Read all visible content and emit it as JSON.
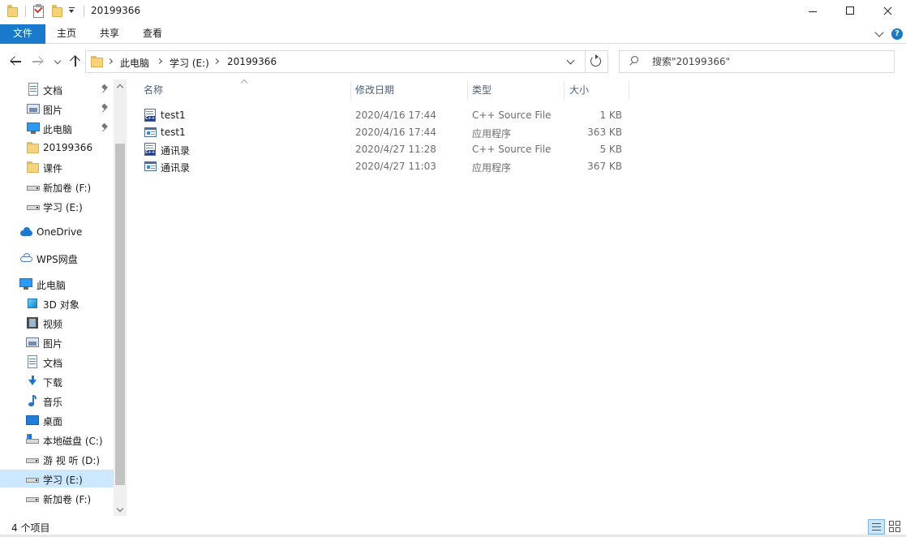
{
  "window": {
    "title": "20199366",
    "controls": [
      "minimize-icon",
      "maximize-icon",
      "close-icon"
    ]
  },
  "ribbon": {
    "file_tab": "文件",
    "tabs": [
      "主页",
      "共享",
      "查看"
    ]
  },
  "address": {
    "crumbs": [
      "此电脑",
      "学习 (E:)",
      "20199366"
    ]
  },
  "search": {
    "placeholder": "搜索\"20199366\""
  },
  "nav": {
    "quick_access": [
      {
        "label": "文档",
        "icon": "documents-icon",
        "pinned": true
      },
      {
        "label": "图片",
        "icon": "pictures-icon",
        "pinned": true
      },
      {
        "label": "此电脑",
        "icon": "this-pc-icon",
        "pinned": true
      },
      {
        "label": "20199366",
        "icon": "folder-icon",
        "pinned": false
      },
      {
        "label": "课件",
        "icon": "folder-icon",
        "pinned": false
      },
      {
        "label": "新加卷 (F:)",
        "icon": "drive-icon",
        "pinned": false
      },
      {
        "label": "学习 (E:)",
        "icon": "drive-icon",
        "pinned": false
      }
    ],
    "onedrive": "OneDrive",
    "wps": "WPS网盘",
    "this_pc": "此电脑",
    "this_pc_items": [
      {
        "label": "3D 对象",
        "icon": "3d-objects-icon"
      },
      {
        "label": "视频",
        "icon": "videos-icon"
      },
      {
        "label": "图片",
        "icon": "pictures-icon"
      },
      {
        "label": "文档",
        "icon": "documents-icon"
      },
      {
        "label": "下载",
        "icon": "downloads-icon"
      },
      {
        "label": "音乐",
        "icon": "music-icon"
      },
      {
        "label": "桌面",
        "icon": "desktop-icon"
      },
      {
        "label": "本地磁盘 (C:)",
        "icon": "windows-drive-icon"
      },
      {
        "label": "游 视 听 (D:)",
        "icon": "drive-icon"
      },
      {
        "label": "学习 (E:)",
        "icon": "drive-icon",
        "selected": true
      },
      {
        "label": "新加卷 (F:)",
        "icon": "drive-icon"
      }
    ]
  },
  "columns": [
    "名称",
    "修改日期",
    "类型",
    "大小"
  ],
  "files": [
    {
      "name": "test1",
      "date": "2020/4/16 17:44",
      "type": "C++ Source File",
      "size": "1 KB",
      "icon": "cpp-file-icon"
    },
    {
      "name": "test1",
      "date": "2020/4/16 17:44",
      "type": "应用程序",
      "size": "363 KB",
      "icon": "exe-file-icon"
    },
    {
      "name": "通讯录",
      "date": "2020/4/27 11:28",
      "type": "C++ Source File",
      "size": "5 KB",
      "icon": "cpp-file-icon"
    },
    {
      "name": "通讯录",
      "date": "2020/4/27 11:03",
      "type": "应用程序",
      "size": "367 KB",
      "icon": "exe-file-icon"
    }
  ],
  "status": {
    "item_count": "4 个项目"
  },
  "colors": {
    "accent": "#1979ca",
    "selection": "#cce8ff"
  }
}
